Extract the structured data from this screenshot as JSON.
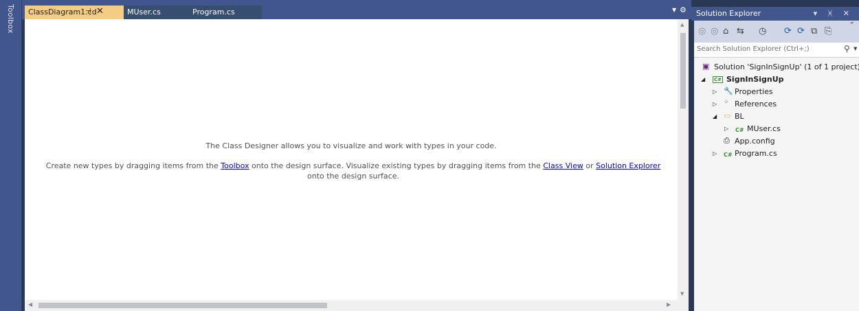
{
  "toolbox": {
    "label": "Toolbox"
  },
  "tabs": [
    {
      "label": "ClassDiagram1.cd",
      "active": true,
      "pin": "⊣",
      "close": "✕"
    },
    {
      "label": "MUser.cs",
      "active": false
    },
    {
      "label": "Program.cs",
      "active": false
    }
  ],
  "tabbar": {
    "overflow": "▼",
    "gear": "⚙"
  },
  "designer": {
    "line1": "The Class Designer allows you to visualize and work with types in your code.",
    "para_part1": "Create new types by dragging items from the ",
    "link_toolbox": "Toolbox",
    "para_part2": " onto the design surface. Visualize existing types by dragging items from the ",
    "link_classview": "Class View",
    "para_part3": " or ",
    "link_solution": "Solution Explorer",
    "para_part4": " onto the design surface."
  },
  "solution_explorer": {
    "title": "Solution Explorer",
    "header_buttons": "▾ ᚸ ✕",
    "search_placeholder": "Search Solution Explorer (Ctrl+;)",
    "search_icon": "⚲",
    "tree": {
      "solution": "Solution 'SignInSignUp' (1 of 1 project)",
      "project": "SignInSignUp",
      "properties": "Properties",
      "references": "References",
      "folder_bl": "BL",
      "muser": "MUser.cs",
      "appconfig": "App.config",
      "program": "Program.cs"
    },
    "icons": {
      "back": "◎",
      "forward": "◎",
      "home": "⌂",
      "sync": "⇆",
      "history": "◷",
      "refresh": "⟳",
      "collapse": "⧉",
      "showall": "⎘",
      "more": "˝"
    }
  },
  "colors": {
    "chrome": "#293955",
    "tab_active": "#f5cc84",
    "link": "#0000ee"
  }
}
